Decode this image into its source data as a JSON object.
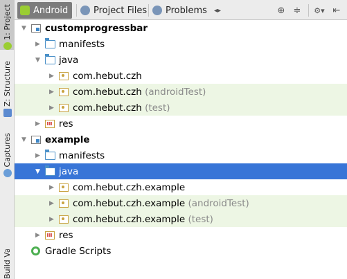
{
  "sidebar": {
    "tabs": [
      {
        "label": "1: Project",
        "icon": "android-icon"
      },
      {
        "label": "Z: Structure",
        "icon": "structure-icon"
      },
      {
        "label": "Captures",
        "icon": "captures-icon"
      },
      {
        "label": "Build Variants",
        "icon": ""
      }
    ]
  },
  "toolbar": {
    "tabs": [
      {
        "label": "Android",
        "icon": "android-icon",
        "active": true
      },
      {
        "label": "Project Files",
        "icon": "globe-icon",
        "active": false
      },
      {
        "label": "Problems",
        "icon": "globe-icon",
        "active": false
      }
    ],
    "scroll_icon": "◂▸",
    "sync_icon": "⊕",
    "collapse_icon": "≑",
    "gear_icon": "⚙▾",
    "hide_icon": "⇤"
  },
  "tree": {
    "rows": [
      {
        "label": "customprogressbar",
        "suffix": "",
        "icon": "module",
        "bold": true,
        "expanded": true,
        "level": 0
      },
      {
        "label": "manifests",
        "suffix": "",
        "icon": "folder",
        "bold": false,
        "expanded": false,
        "level": 1
      },
      {
        "label": "java",
        "suffix": "",
        "icon": "folder",
        "bold": false,
        "expanded": true,
        "level": 1
      },
      {
        "label": "com.hebut.czh",
        "suffix": "",
        "icon": "package",
        "bold": false,
        "expanded": false,
        "level": 2
      },
      {
        "label": "com.hebut.czh",
        "suffix": "(androidTest)",
        "icon": "package",
        "bold": false,
        "expanded": false,
        "level": 2,
        "highlight": true
      },
      {
        "label": "com.hebut.czh",
        "suffix": "(test)",
        "icon": "package",
        "bold": false,
        "expanded": false,
        "level": 2,
        "highlight": true
      },
      {
        "label": "res",
        "suffix": "",
        "icon": "res",
        "bold": false,
        "expanded": false,
        "level": 1
      },
      {
        "label": "example",
        "suffix": "",
        "icon": "module",
        "bold": true,
        "expanded": true,
        "level": 0
      },
      {
        "label": "manifests",
        "suffix": "",
        "icon": "folder",
        "bold": false,
        "expanded": false,
        "level": 1
      },
      {
        "label": "java",
        "suffix": "",
        "icon": "folder",
        "bold": false,
        "expanded": true,
        "level": 1,
        "selected": true
      },
      {
        "label": "com.hebut.czh.example",
        "suffix": "",
        "icon": "package",
        "bold": false,
        "expanded": false,
        "level": 2
      },
      {
        "label": "com.hebut.czh.example",
        "suffix": "(androidTest)",
        "icon": "package",
        "bold": false,
        "expanded": false,
        "level": 2,
        "highlight": true
      },
      {
        "label": "com.hebut.czh.example",
        "suffix": "(test)",
        "icon": "package",
        "bold": false,
        "expanded": false,
        "level": 2,
        "highlight": true
      },
      {
        "label": "res",
        "suffix": "",
        "icon": "res",
        "bold": false,
        "expanded": false,
        "level": 1
      },
      {
        "label": "Gradle Scripts",
        "suffix": "",
        "icon": "gradle",
        "bold": false,
        "expanded": false,
        "level": 0
      }
    ]
  },
  "colors": {
    "selection": "#3875d7",
    "test_highlight": "#edf6e4",
    "active_tab": "#7c7c7c"
  }
}
